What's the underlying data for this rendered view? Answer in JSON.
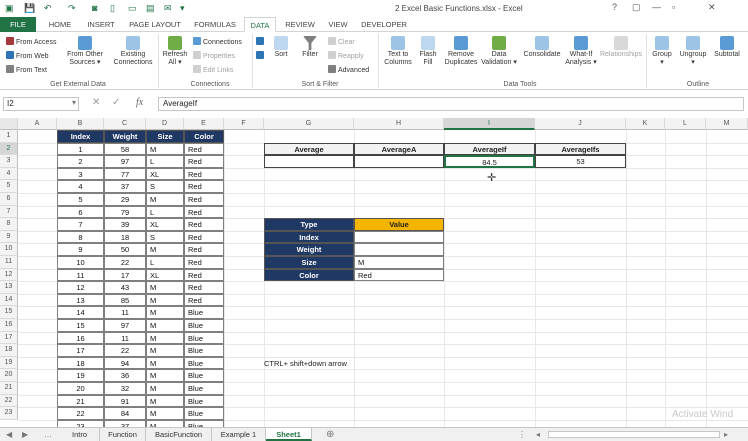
{
  "window": {
    "title": "2 Excel Basic Functions.xlsx - Excel",
    "controls": [
      "?",
      "▢",
      "—",
      "▫",
      "✕"
    ]
  },
  "tabs": [
    "FILE",
    "HOME",
    "INSERT",
    "PAGE LAYOUT",
    "FORMULAS",
    "DATA",
    "REVIEW",
    "VIEW",
    "DEVELOPER"
  ],
  "active_tab": "DATA",
  "ribbon": {
    "get_external_data": {
      "label": "Get External Data",
      "from_access": "From Access",
      "from_web": "From Web",
      "from_text": "From Text",
      "from_other_sources": [
        "From Other",
        "Sources ▾"
      ],
      "existing_connections": [
        "Existing",
        "Connections"
      ]
    },
    "connections": {
      "label": "Connections",
      "refresh_all": [
        "Refresh",
        "All ▾"
      ],
      "connections": "Connections",
      "properties": "Properties",
      "edit_links": "Edit Links"
    },
    "sort_filter": {
      "label": "Sort & Filter",
      "sort": "Sort",
      "filter": "Filter",
      "clear": "Clear",
      "reapply": "Reapply",
      "advanced": "Advanced"
    },
    "data_tools": {
      "label": "Data Tools",
      "text_to_columns": [
        "Text to",
        "Columns"
      ],
      "flash_fill": [
        "Flash",
        "Fill"
      ],
      "remove_duplicates": [
        "Remove",
        "Duplicates"
      ],
      "data_validation": [
        "Data",
        "Validation ▾"
      ],
      "consolidate": "Consolidate",
      "what_if": [
        "What-If",
        "Analysis ▾"
      ],
      "relationships": "Relationships"
    },
    "outline": {
      "label": "Outline",
      "group": [
        "Group",
        "▾"
      ],
      "ungroup": [
        "Ungroup",
        "▾"
      ],
      "subtotal": "Subtotal"
    }
  },
  "formula_bar": {
    "name_box": "I2",
    "fx": "fx",
    "formula": "AverageIf"
  },
  "columns": [
    "A",
    "B",
    "C",
    "D",
    "E",
    "F",
    "G",
    "H",
    "I",
    "J",
    "K",
    "L",
    "M"
  ],
  "rows": [
    "1",
    "2",
    "3",
    "4",
    "5",
    "6",
    "7",
    "8",
    "9",
    "10",
    "11",
    "12",
    "13",
    "14",
    "15",
    "16",
    "17",
    "18",
    "19",
    "20",
    "21",
    "22",
    "23"
  ],
  "table": {
    "headers": [
      "Index",
      "Weight",
      "Size",
      "Color"
    ],
    "rows": [
      [
        "1",
        "58",
        "M",
        "Red"
      ],
      [
        "2",
        "97",
        "L",
        "Red"
      ],
      [
        "3",
        "77",
        "XL",
        "Red"
      ],
      [
        "4",
        "37",
        "S",
        "Red"
      ],
      [
        "5",
        "29",
        "M",
        "Red"
      ],
      [
        "6",
        "79",
        "L",
        "Red"
      ],
      [
        "7",
        "39",
        "XL",
        "Red"
      ],
      [
        "8",
        "18",
        "S",
        "Red"
      ],
      [
        "9",
        "50",
        "M",
        "Red"
      ],
      [
        "10",
        "22",
        "L",
        "Red"
      ],
      [
        "11",
        "17",
        "XL",
        "Red"
      ],
      [
        "12",
        "43",
        "M",
        "Red"
      ],
      [
        "13",
        "85",
        "M",
        "Red"
      ],
      [
        "14",
        "11",
        "M",
        "Blue"
      ],
      [
        "15",
        "97",
        "M",
        "Blue"
      ],
      [
        "16",
        "11",
        "M",
        "Blue"
      ],
      [
        "17",
        "22",
        "M",
        "Blue"
      ],
      [
        "18",
        "94",
        "M",
        "Blue"
      ],
      [
        "19",
        "36",
        "M",
        "Blue"
      ],
      [
        "20",
        "32",
        "M",
        "Blue"
      ],
      [
        "21",
        "91",
        "M",
        "Blue"
      ],
      [
        "22",
        "84",
        "M",
        "Blue"
      ],
      [
        "23",
        "37",
        "M",
        "Blue"
      ]
    ]
  },
  "avg_table": {
    "headers": [
      "Average",
      "AverageA",
      "AverageIf",
      "AverageIfs"
    ],
    "values": [
      "",
      "",
      "84.5",
      "53"
    ]
  },
  "criteria_table": {
    "headers": [
      "Type",
      "Value"
    ],
    "rows": [
      [
        "Index",
        ""
      ],
      [
        "Weight",
        ""
      ],
      [
        "Size",
        "M"
      ],
      [
        "Color",
        "Red"
      ]
    ]
  },
  "note": "CTRL+ shift+down arrow",
  "sheet_tabs": [
    "Intro",
    "Function",
    "BasicFunction",
    "Example 1",
    "Sheet1"
  ],
  "active_sheet": "Sheet1",
  "watermark": "Activate Wind",
  "colors": {
    "excel_green": "#217346",
    "table_header": "#1f3864",
    "value_header": "#f4b400"
  }
}
